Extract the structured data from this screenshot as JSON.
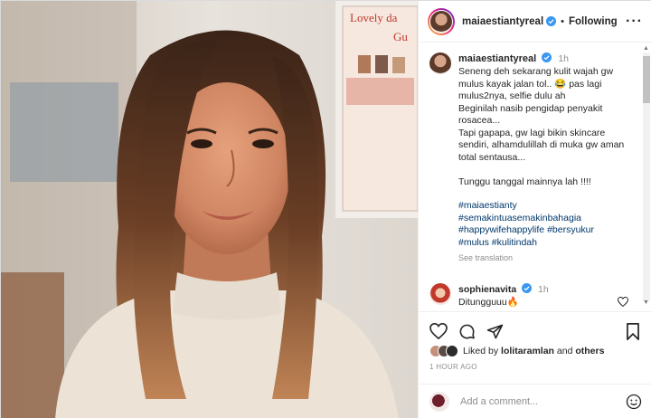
{
  "post": {
    "username": "maiaestiantyreal",
    "follow_label": "Following",
    "more_label": "···",
    "separator": "•"
  },
  "photo": {
    "poster_text_line1": "Lovely da",
    "poster_text_line2": "Gu"
  },
  "caption": {
    "username": "maiaestiantyreal",
    "time": "1h",
    "text": "Seneng deh sekarang kulit wajah gw mulus kayak jalan tol.. 😂 pas lagi mulus2nya, selfie dulu ah\nBeginilah nasib pengidap penyakit rosacea...\nTapi gapapa, gw lagi bikin skincare sendiri, alhamdulillah di muka gw aman total sentausa...\n\nTunggu tanggal mainnya lah !!!!",
    "hashtags": [
      "#maiaestianty",
      "#semakintuasemakinbahagia",
      "#happywifehappylife #bersyukur",
      "#mulus #kulitindah"
    ],
    "see_translation": "See translation"
  },
  "comments": [
    {
      "username": "sophienavita",
      "time": "1h",
      "text": "Ditungguuu🔥"
    }
  ],
  "likes": {
    "prefix": "Liked by",
    "user": "lolitaramlan",
    "and": "and",
    "others": "others"
  },
  "timestamp": "1 HOUR AGO",
  "add_comment": {
    "placeholder": "Add a comment..."
  },
  "icons": {
    "verified": "verified-badge-icon",
    "like": "heart-icon",
    "comment": "comment-icon",
    "share": "share-icon",
    "save": "bookmark-icon",
    "emoji": "emoji-icon"
  },
  "colors": {
    "verified_blue": "#3897f0",
    "hashtag": "#00376b",
    "muted": "#8e8e8e"
  }
}
